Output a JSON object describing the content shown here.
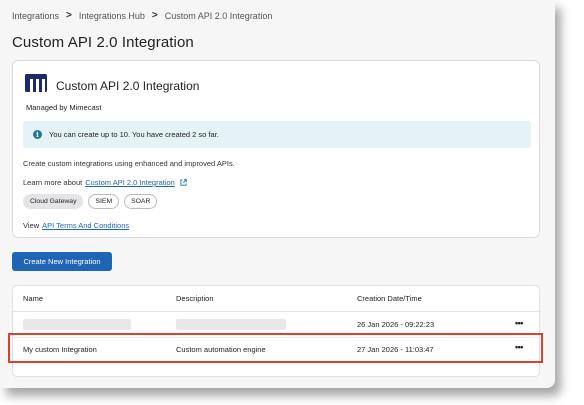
{
  "breadcrumb": {
    "items": [
      "Integrations",
      "Integrations Hub",
      "Custom API 2.0 Integration"
    ],
    "separator": ">"
  },
  "page": {
    "title": "Custom API 2.0 Integration"
  },
  "card": {
    "title": "Custom API 2.0 Integration",
    "managed_by": "Managed by Mimecast",
    "info": "You can create up to 10. You have created 2 so far.",
    "description": "Create custom integrations using enhanced and improved APIs.",
    "learn_prefix": "Learn more about",
    "learn_link": "Custom API 2.0 Integration",
    "tags": [
      "Cloud Gateway",
      "SIEM",
      "SOAR"
    ],
    "terms_prefix": "View",
    "terms_link": "API Terms And Conditions"
  },
  "actions": {
    "create_label": "Create New Integration"
  },
  "table": {
    "columns": [
      "Name",
      "Description",
      "Creation Date/Time"
    ],
    "rows": [
      {
        "name": "",
        "description": "",
        "date": "26 Jan 2026 - 09:22:23",
        "more": "•••"
      },
      {
        "name": "My custom Integration",
        "description": "Custom automation engine",
        "date": "27 Jan 2026 - 11:03:47",
        "more": "•••"
      }
    ]
  },
  "colors": {
    "accent": "#1f65b5",
    "link": "#2266b7",
    "info_bg": "#e6f3f6",
    "highlight": "#d8422e",
    "logo": "#1a2a6c"
  }
}
